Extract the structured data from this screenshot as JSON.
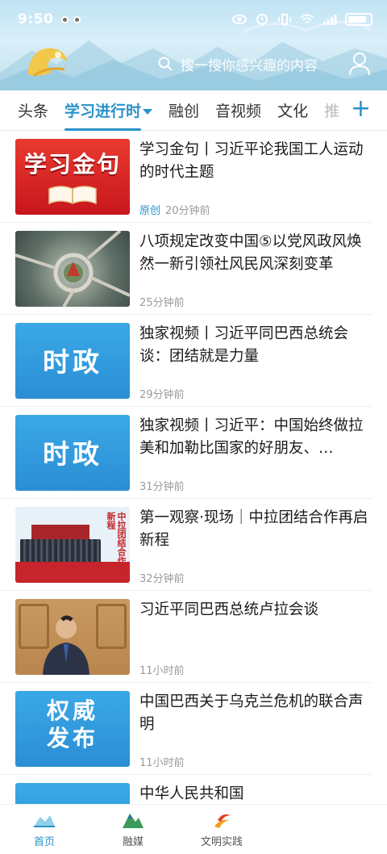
{
  "statusbar": {
    "time": "9:50"
  },
  "header": {
    "search_placeholder": "搜一搜你感兴趣的内容"
  },
  "tabs": [
    {
      "label": "头条"
    },
    {
      "label": "学习进行时"
    },
    {
      "label": "融创"
    },
    {
      "label": "音视频"
    },
    {
      "label": "文化"
    },
    {
      "label": "推"
    }
  ],
  "thumbs": {
    "gold": "学习金句",
    "shizheng": "时政",
    "quanwei": "权威发布",
    "banner_side": "中拉团结合作再启新程"
  },
  "news": [
    {
      "title": "学习金句丨习近平论我国工人运动的时代主题",
      "origin": "原创",
      "time": "20分钟前"
    },
    {
      "title": "八项规定改变中国⑤以党风政风焕然一新引领社风民风深刻变革",
      "time": "25分钟前"
    },
    {
      "title": "独家视频丨习近平同巴西总统会谈：团结就是力量",
      "time": "29分钟前"
    },
    {
      "title": "独家视频丨习近平：中国始终做拉美和加勒比国家的好朋友、…",
      "time": "31分钟前"
    },
    {
      "title": "第一观察·现场｜中拉团结合作再启新程",
      "time": "32分钟前"
    },
    {
      "title": "习近平同巴西总统卢拉会谈",
      "time": "11小时前"
    },
    {
      "title": "中国巴西关于乌克兰危机的联合声明",
      "time": "11小时前"
    },
    {
      "title": "中华人民共和国"
    }
  ],
  "bottomnav": [
    {
      "label": "首页"
    },
    {
      "label": "融媒"
    },
    {
      "label": "文明实践"
    }
  ],
  "colors": {
    "accent": "#2a92c9",
    "red": "#c8161d"
  }
}
